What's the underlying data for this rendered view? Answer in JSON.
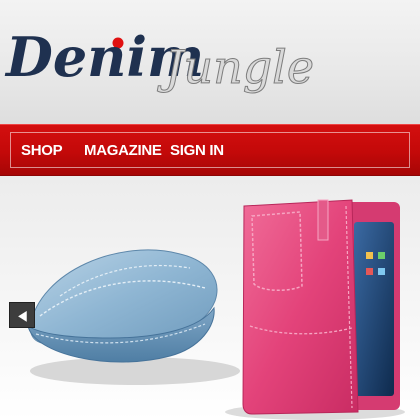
{
  "logo": {
    "word1": "Denim",
    "word2": "Jungle",
    "dot_color": "#e01010",
    "text_color": "#1f3150"
  },
  "nav": {
    "items": [
      {
        "label": "SHOP"
      },
      {
        "label": "MAGAZINE"
      },
      {
        "label": "SIGN IN"
      }
    ],
    "bar_color": "#c80c0c"
  },
  "slider": {
    "prev_icon": "chevron-left-icon",
    "products": [
      {
        "name": "denim flat cap",
        "color": "#8fb6d3"
      },
      {
        "name": "pink denim tablet case",
        "color": "#e3437a"
      }
    ]
  }
}
